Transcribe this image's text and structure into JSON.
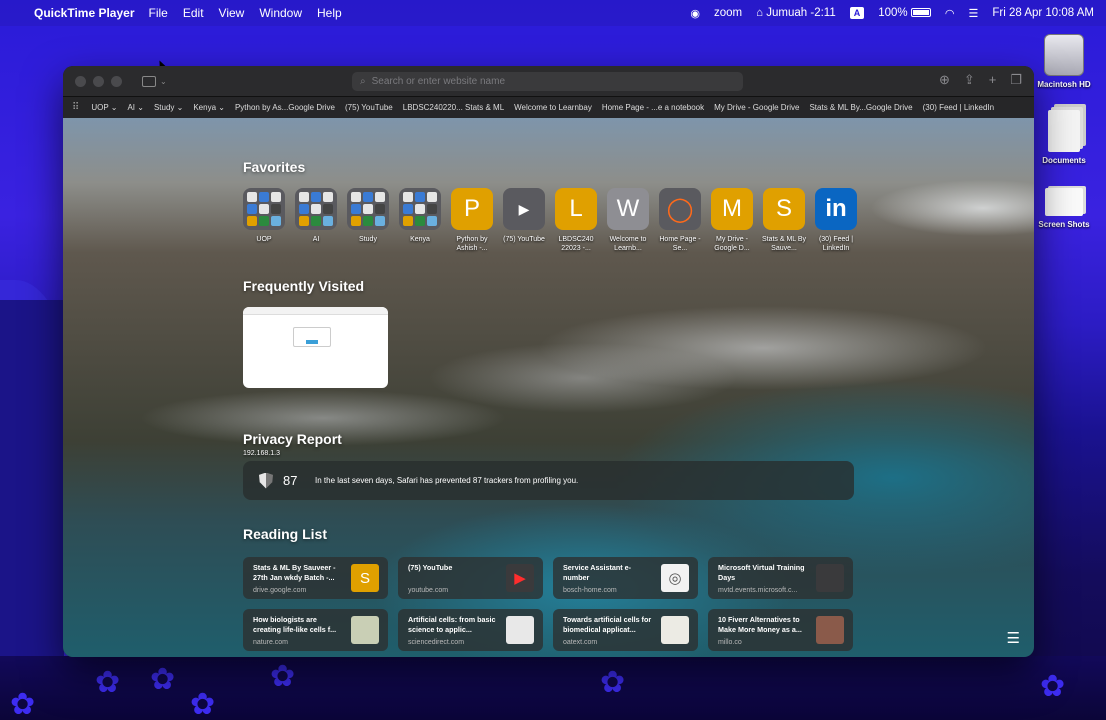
{
  "menubar": {
    "app_name": "QuickTime Player",
    "items": [
      "File",
      "Edit",
      "View",
      "Window",
      "Help"
    ],
    "zoom": "zoom",
    "prayer": "Jumuah -2:11",
    "input_source": "A",
    "battery": "100%",
    "datetime": "Fri 28 Apr  10:08 AM"
  },
  "desktop": {
    "icons": [
      {
        "label": "Macintosh HD",
        "icon": "hard-drive-icon"
      },
      {
        "label": "Documents",
        "icon": "documents-icon"
      },
      {
        "label": "Screen Shots",
        "icon": "screenshots-icon"
      }
    ]
  },
  "safari": {
    "search_placeholder": "Search or enter website name",
    "bookmarks": [
      "UOP ⌄",
      "AI ⌄",
      "Study ⌄",
      "Kenya ⌄",
      "Python by As...Google Drive",
      "(75) YouTube",
      "LBDSC240220... Stats & ML",
      "Welcome to Learnbay",
      "Home Page - ...e a notebook",
      "My Drive - Google Drive",
      "Stats & ML By...Google Drive",
      "(30) Feed | LinkedIn"
    ],
    "favorites_title": "Favorites",
    "favorites": [
      {
        "label": "UOP",
        "letter": "",
        "color": "#5a5a5f",
        "folder": true
      },
      {
        "label": "AI",
        "letter": "",
        "color": "#5a5a5f",
        "folder": true
      },
      {
        "label": "Study",
        "letter": "",
        "color": "#5a5a5f",
        "folder": true
      },
      {
        "label": "Kenya",
        "letter": "",
        "color": "#5a5a5f",
        "folder": true
      },
      {
        "label": "Python by Ashish -...",
        "letter": "P",
        "color": "#e0a000"
      },
      {
        "label": "(75) YouTube",
        "letter": "▶",
        "color": "#5a5a5f"
      },
      {
        "label": "LBDSC240 22023 -...",
        "letter": "L",
        "color": "#e0a000"
      },
      {
        "label": "Welcome to Learnb...",
        "letter": "W",
        "color": "#8e8e93"
      },
      {
        "label": "Home Page - Se...",
        "letter": "◯",
        "color": "#5a5a5f"
      },
      {
        "label": "My Drive - Google D...",
        "letter": "M",
        "color": "#e0a000"
      },
      {
        "label": "Stats & ML By Sauve...",
        "letter": "S",
        "color": "#e0a000"
      },
      {
        "label": "(30) Feed | LinkedIn",
        "letter": "in",
        "color": "#0a66c2"
      }
    ],
    "frequently_title": "Frequently Visited",
    "frequently": [
      {
        "label": "192.168.1.3"
      }
    ],
    "privacy_title": "Privacy Report",
    "privacy": {
      "count": "87",
      "message": "In the last seven days, Safari has prevented 87 trackers from profiling you."
    },
    "reading_title": "Reading List",
    "reading": [
      {
        "title": "Stats & ML By Sauveer - 27th Jan wkdy Batch -...",
        "domain": "drive.google.com",
        "thumb": "S",
        "thumb_color": "#e0a000"
      },
      {
        "title": "(75) YouTube",
        "domain": "youtube.com",
        "thumb": "▶",
        "thumb_color": "#3a3a3c"
      },
      {
        "title": "Service Assistant e-number",
        "domain": "bosch-home.com",
        "thumb": "◎",
        "thumb_color": "#f2f2f2"
      },
      {
        "title": "Microsoft Virtual Training Days",
        "domain": "mvtd.events.microsoft.c...",
        "thumb": "",
        "thumb_color": "#3a3a3c"
      },
      {
        "title": "How biologists are creating life-like cells f...",
        "domain": "nature.com",
        "thumb": "",
        "thumb_color": "#c9cfb5"
      },
      {
        "title": "Artificial cells: from basic science to applic...",
        "domain": "sciencedirect.com",
        "thumb": "",
        "thumb_color": "#e8e8e8"
      },
      {
        "title": "Towards artificial cells for biomedical applicat...",
        "domain": "oatext.com",
        "thumb": "",
        "thumb_color": "#ecebe4"
      },
      {
        "title": "10 Fiverr Alternatives to Make More Money as a...",
        "domain": "millo.co",
        "thumb": "",
        "thumb_color": "#8a5a4a"
      }
    ]
  }
}
